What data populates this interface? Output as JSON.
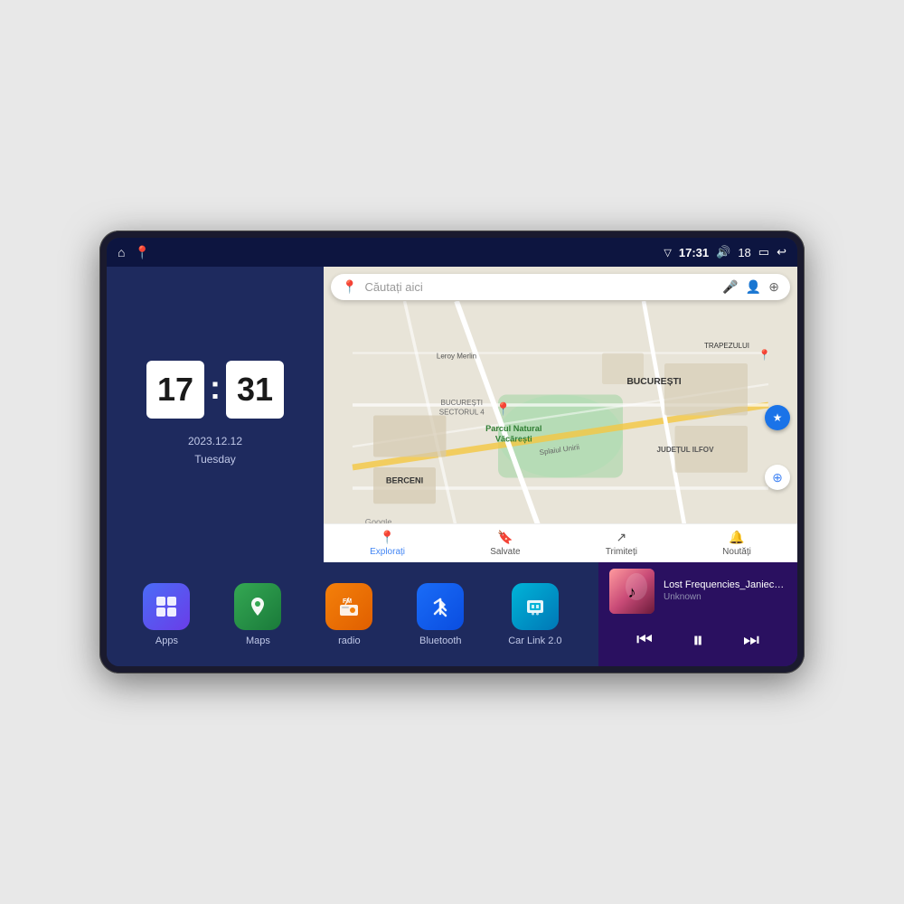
{
  "device": {
    "status_bar": {
      "left_icons": [
        "home",
        "maps"
      ],
      "time": "17:31",
      "volume_icon": "🔊",
      "battery_level": "18",
      "battery_icon": "🔋",
      "back_icon": "↩"
    },
    "clock": {
      "hour": "17",
      "minute": "31",
      "date": "2023.12.12",
      "day": "Tuesday"
    },
    "map": {
      "search_placeholder": "Căutați aici",
      "tabs": [
        {
          "label": "Explorați",
          "active": true
        },
        {
          "label": "Salvate",
          "active": false
        },
        {
          "label": "Trimiteți",
          "active": false
        },
        {
          "label": "Noutăți",
          "active": false
        }
      ],
      "locations": [
        "Parcul Natural Văcărești",
        "BUCUREȘTI",
        "JUDEȚUL ILFOV",
        "BERCENI",
        "Leroy Merlin",
        "TRAPEZULUI",
        "BUCUREȘTI SECTORUL 4"
      ],
      "road_label": "Splaiul Unirii"
    },
    "apps": [
      {
        "id": "apps",
        "label": "Apps",
        "icon": "⊞",
        "color": "blue-gradient"
      },
      {
        "id": "maps",
        "label": "Maps",
        "icon": "📍",
        "color": "green-map"
      },
      {
        "id": "radio",
        "label": "radio",
        "icon": "📻",
        "color": "radio-orange"
      },
      {
        "id": "bluetooth",
        "label": "Bluetooth",
        "icon": "⚡",
        "color": "bt-blue"
      },
      {
        "id": "carlink",
        "label": "Car Link 2.0",
        "icon": "📱",
        "color": "carlink-teal"
      }
    ],
    "music": {
      "title": "Lost Frequencies_Janieck Devy-...",
      "artist": "Unknown",
      "controls": {
        "prev": "⏮",
        "play": "⏸",
        "next": "⏭"
      }
    }
  }
}
